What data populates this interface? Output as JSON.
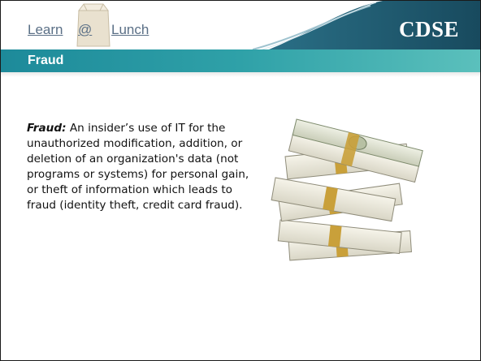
{
  "header": {
    "brand_learn": "Learn",
    "brand_at": "@",
    "brand_lunch": "Lunch",
    "org": "CDSE"
  },
  "slide": {
    "title": "Fraud",
    "term": "Fraud:",
    "definition": " An insider’s use of IT for the unauthorized modification, addition, or deletion of an organization's data (not programs or systems) for personal gain, or theft of information which leads to fraud (identity theft, credit card fraud)."
  },
  "image": {
    "subject": "money-stack-icon"
  },
  "colors": {
    "header_dark": "#1f5a6e",
    "title_bar": "#2a9aa5",
    "accent": "#5a6f86"
  }
}
